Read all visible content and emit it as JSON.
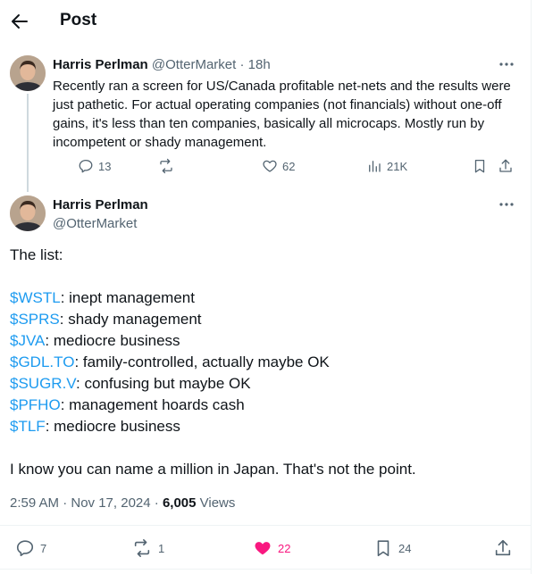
{
  "header": {
    "title": "Post"
  },
  "parent": {
    "name": "Harris Perlman",
    "handle": "@OtterMarket",
    "separator": "·",
    "time": "18h",
    "text": "Recently ran a screen for US/Canada profitable net-nets and the results were just pathetic. For actual operating companies (not financials) without one-off gains, it's less than ten companies, basically all microcaps. Mostly run by incompetent or shady management.",
    "stats": {
      "replies": "13",
      "likes": "62",
      "views": "21K"
    }
  },
  "main": {
    "name": "Harris Perlman",
    "handle": "@OtterMarket",
    "intro": "The list:",
    "tickers": [
      {
        "symbol": "$WSTL",
        "note": ": inept management"
      },
      {
        "symbol": "$SPRS",
        "note": ": shady management"
      },
      {
        "symbol": "$JVA",
        "note": ": mediocre business"
      },
      {
        "symbol": "$GDL.TO",
        "note": ": family-controlled, actually maybe OK"
      },
      {
        "symbol": "$SUGR.V",
        "note": ": confusing but maybe OK"
      },
      {
        "symbol": "$PFHO",
        "note": ": management hoards cash"
      },
      {
        "symbol": "$TLF",
        "note": ": mediocre business"
      }
    ],
    "closing": "I know you can name a million in Japan. That's not the point.",
    "timestamp": "2:59 AM · Nov 17, 2024 · ",
    "views_count": "6,005",
    "views_label": " Views",
    "stats": {
      "replies": "7",
      "reposts": "1",
      "likes": "22",
      "bookmarks": "24"
    }
  },
  "colors": {
    "accent": "#1d9bf0",
    "like": "#f91880",
    "muted": "#536471",
    "text": "#0f1419"
  }
}
